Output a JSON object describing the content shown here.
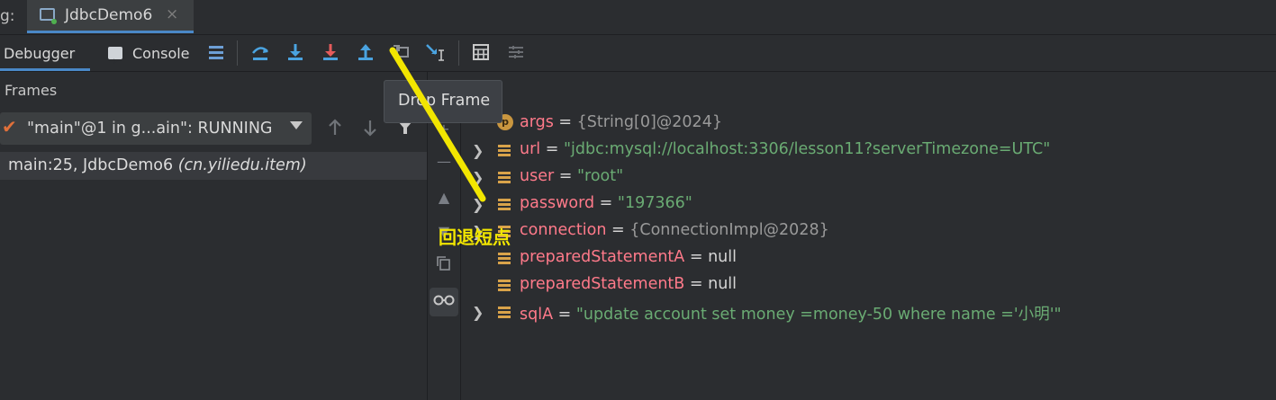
{
  "tabbar": {
    "prefix": "g:",
    "active_tab": "JdbcDemo6",
    "close_glyph": "×",
    "tab_icon": "app-window-icon"
  },
  "toolbar": {
    "debugger_label": "Debugger",
    "console_label": "Console",
    "icons": [
      "restore-layout-icon",
      "step-over-icon",
      "step-into-icon",
      "force-step-into-icon",
      "step-out-icon",
      "drop-frame-icon",
      "run-to-cursor-icon",
      "evaluate-expression-icon",
      "trace-current-stream-icon"
    ]
  },
  "frames": {
    "title": "Frames",
    "thread_label": "\"main\"@1 in g...ain\": RUNNING",
    "frame_main": "main:25, JdbcDemo6 ",
    "frame_pkg": "(cn.yiliedu.item)"
  },
  "tooltip": "Drop Frame",
  "annotation": "回退短点",
  "annotation_color": "#f2e600",
  "variables": [
    {
      "name": "args",
      "value": "{String[0]@2024}",
      "kind": "param",
      "expandable": false
    },
    {
      "name": "url",
      "value": "\"jdbc:mysql://localhost:3306/lesson11?serverTimezone=UTC\"",
      "kind": "field",
      "expandable": true
    },
    {
      "name": "user",
      "value": "\"root\"",
      "kind": "field",
      "expandable": true
    },
    {
      "name": "password",
      "value": "\"197366\"",
      "kind": "field",
      "expandable": true
    },
    {
      "name": "connection",
      "value": "{ConnectionImpl@2028}",
      "kind": "field",
      "expandable": true
    },
    {
      "name": "preparedStatementA",
      "value": "null",
      "kind": "field",
      "expandable": false
    },
    {
      "name": "preparedStatementB",
      "value": "null",
      "kind": "field",
      "expandable": false
    },
    {
      "name": "sqlA",
      "value": "\"update account set money =money-50 where name ='小明'\"",
      "kind": "field",
      "expandable": true
    }
  ]
}
